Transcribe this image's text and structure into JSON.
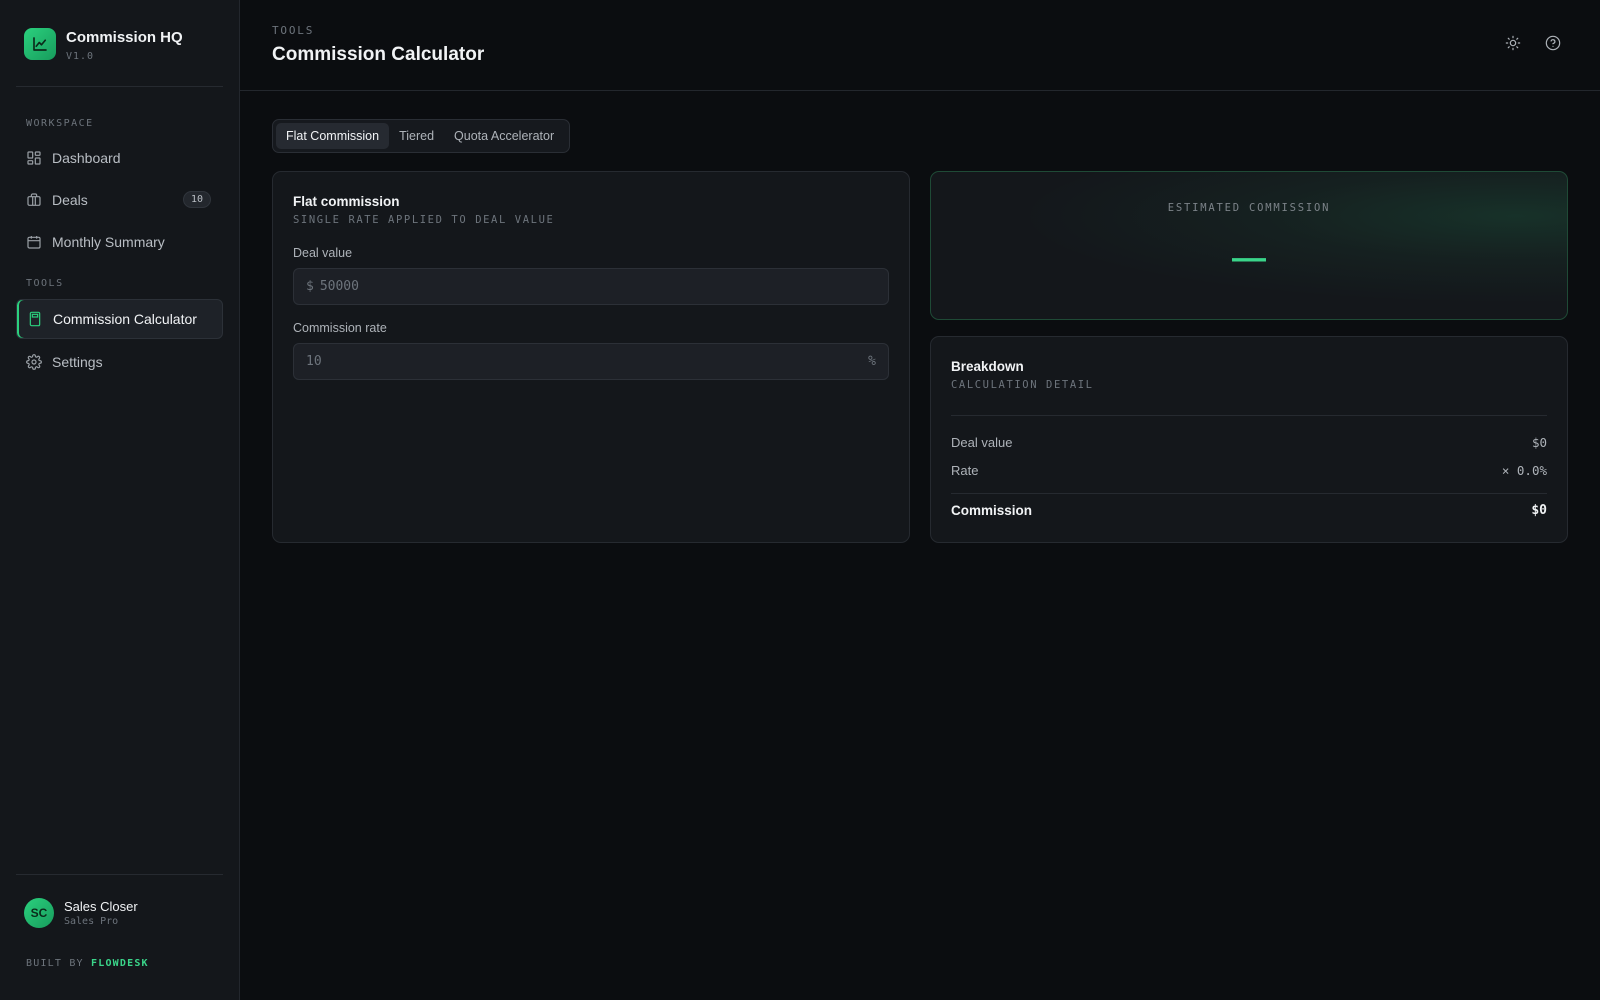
{
  "brand": {
    "title": "Commission HQ",
    "version": "V1.0"
  },
  "sidebar": {
    "workspace_label": "WORKSPACE",
    "tools_label": "TOOLS",
    "items": [
      {
        "label": "Dashboard",
        "icon": "dashboard-icon"
      },
      {
        "label": "Deals",
        "icon": "briefcase-icon",
        "badge": "10"
      },
      {
        "label": "Monthly Summary",
        "icon": "calendar-icon"
      },
      {
        "label": "Commission Calculator",
        "icon": "calculator-icon",
        "active": true
      },
      {
        "label": "Settings",
        "icon": "gear-icon"
      }
    ]
  },
  "user": {
    "initials": "SC",
    "name": "Sales Closer",
    "role": "Sales Pro"
  },
  "footer": {
    "built_by": "BUILT BY",
    "brand": "FLOWDESK"
  },
  "header": {
    "eyebrow": "TOOLS",
    "title": "Commission Calculator"
  },
  "tabs": [
    {
      "label": "Flat Commission",
      "active": true
    },
    {
      "label": "Tiered"
    },
    {
      "label": "Quota Accelerator"
    }
  ],
  "form": {
    "title": "Flat commission",
    "subtitle": "SINGLE RATE APPLIED TO DEAL VALUE",
    "deal_value": {
      "label": "Deal value",
      "prefix": "$",
      "placeholder": "50000",
      "value": ""
    },
    "commission_rate": {
      "label": "Commission rate",
      "placeholder": "10",
      "suffix": "%",
      "value": ""
    }
  },
  "estimate": {
    "label": "ESTIMATED COMMISSION",
    "value": "—"
  },
  "breakdown": {
    "title": "Breakdown",
    "subtitle": "CALCULATION DETAIL",
    "rows": [
      {
        "label": "Deal value",
        "value": "$0"
      },
      {
        "label": "Rate",
        "value": "× 0.0%"
      }
    ],
    "total": {
      "label": "Commission",
      "value": "$0"
    }
  },
  "colors": {
    "accent": "#2bd17e",
    "background": "#0b0d10",
    "panel": "#14171b"
  }
}
